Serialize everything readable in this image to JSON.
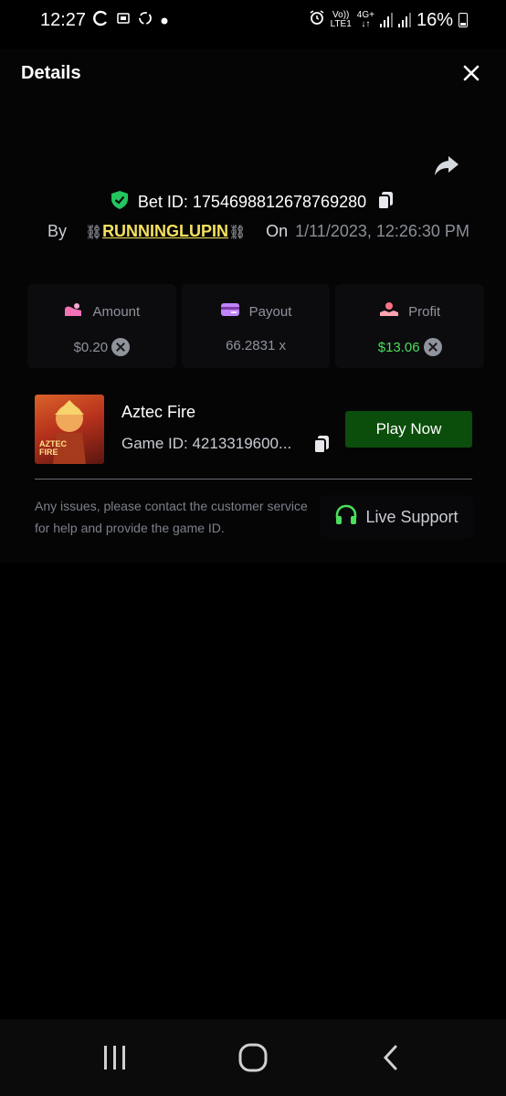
{
  "status_bar": {
    "time": "12:27",
    "left_icons": [
      "sync-icon",
      "notification-icon",
      "share-app-icon",
      "dot-icon"
    ],
    "volte_top": "Vo))",
    "volte_bottom": "LTE1",
    "net_top": "4G+",
    "net_bottom": "↓↑",
    "battery": "16%"
  },
  "header": {
    "title": "Details"
  },
  "bet": {
    "label": "Bet ID:",
    "id": "1754698812678769280"
  },
  "by_row": {
    "by_label": "By",
    "chain": "⛓",
    "username": "RUNNINGLUPIN",
    "on_label": "On",
    "date": "1/11/2023, 12:26:30 PM"
  },
  "stats": {
    "amount_label": "Amount",
    "amount_value": "$0.20",
    "payout_label": "Payout",
    "payout_value": "66.2831 x",
    "profit_label": "Profit",
    "profit_value": "$13.06"
  },
  "game": {
    "name": "Aztec Fire",
    "id_text": "Game ID: 4213319600...",
    "thumb_text_1": "AZTEC",
    "thumb_text_2": "FIRE",
    "play_label": "Play Now"
  },
  "help": {
    "text": "Any issues, please contact the customer service for help and provide the game ID.",
    "live_support_label": "Live Support"
  },
  "colors": {
    "background": "#000000",
    "panel": "#0c0c0f",
    "accent_green": "#0b4d0b",
    "profit_green": "#4ade5a",
    "username_yellow": "#f5e15c",
    "shield_green": "#22c55e",
    "support_green": "#4ade5a"
  }
}
